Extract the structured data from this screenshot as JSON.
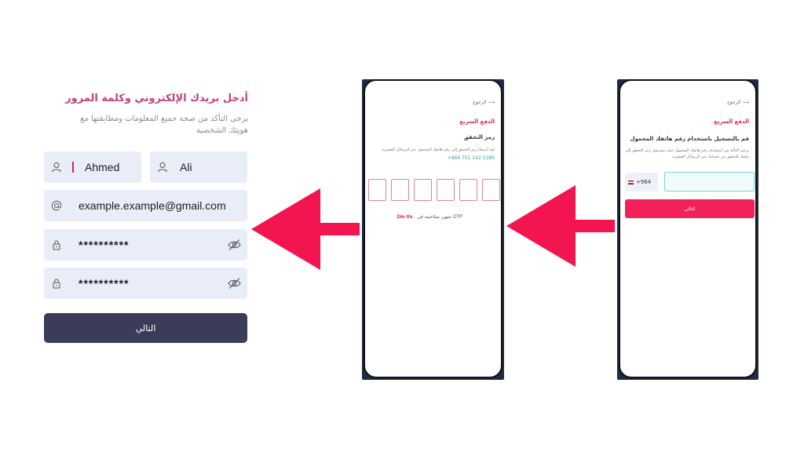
{
  "registration": {
    "title": "أدخل بريدك الإلكتروني وكلمة المرور",
    "subtitle": "يرجى التأكد من صحة جميع المعلومات ومطابقتها مع هويتك الشخصية",
    "first_name_value": "Ahmed",
    "last_name_value": "Ali",
    "email_value": "example.example@gmail.com",
    "password_value": "**********",
    "confirm_password_value": "**********",
    "next_label": "التالي"
  },
  "otp_screen": {
    "back_label": "الرجوع",
    "brand": "الدفع السريع",
    "title": "رمز التحقق",
    "description": "لقد أرسلنا رمز التحقق إلى رقم هاتفك المحمول عبر الرسائل القصيرة",
    "phone_number": "+964 751 142 5380",
    "timer_label": "تنتهي صلاحيته في OTP",
    "timer_value": "2m 0s",
    "otp_boxes": [
      "",
      "",
      "",
      "",
      "",
      ""
    ]
  },
  "phone_screen": {
    "back_label": "الرجوع",
    "brand": "الدفع السريع",
    "title": "قم بالتسجيل باستخدام رقم هاتفك المحمول",
    "description": "يرجى التأكد من استخدام رقم هاتفك المحمول حيث سيرسل رمز التحقق إلى رقمك للتحقق من حسابك عبر الرسائل القصيرة",
    "country_code": "+964",
    "phone_placeholder": "",
    "next_label": "التالي"
  },
  "colors": {
    "accent_red": "#f2215a",
    "title_pink": "#c0437a",
    "dark_button": "#3b3b5a",
    "field_bg": "#e8edf7",
    "teal": "#2aa6a0"
  },
  "icons": [
    "user-icon",
    "at-icon",
    "lock-icon",
    "eye-off-icon",
    "back-arrow-icon",
    "iraq-flag-icon",
    "arrow-left-icon"
  ]
}
